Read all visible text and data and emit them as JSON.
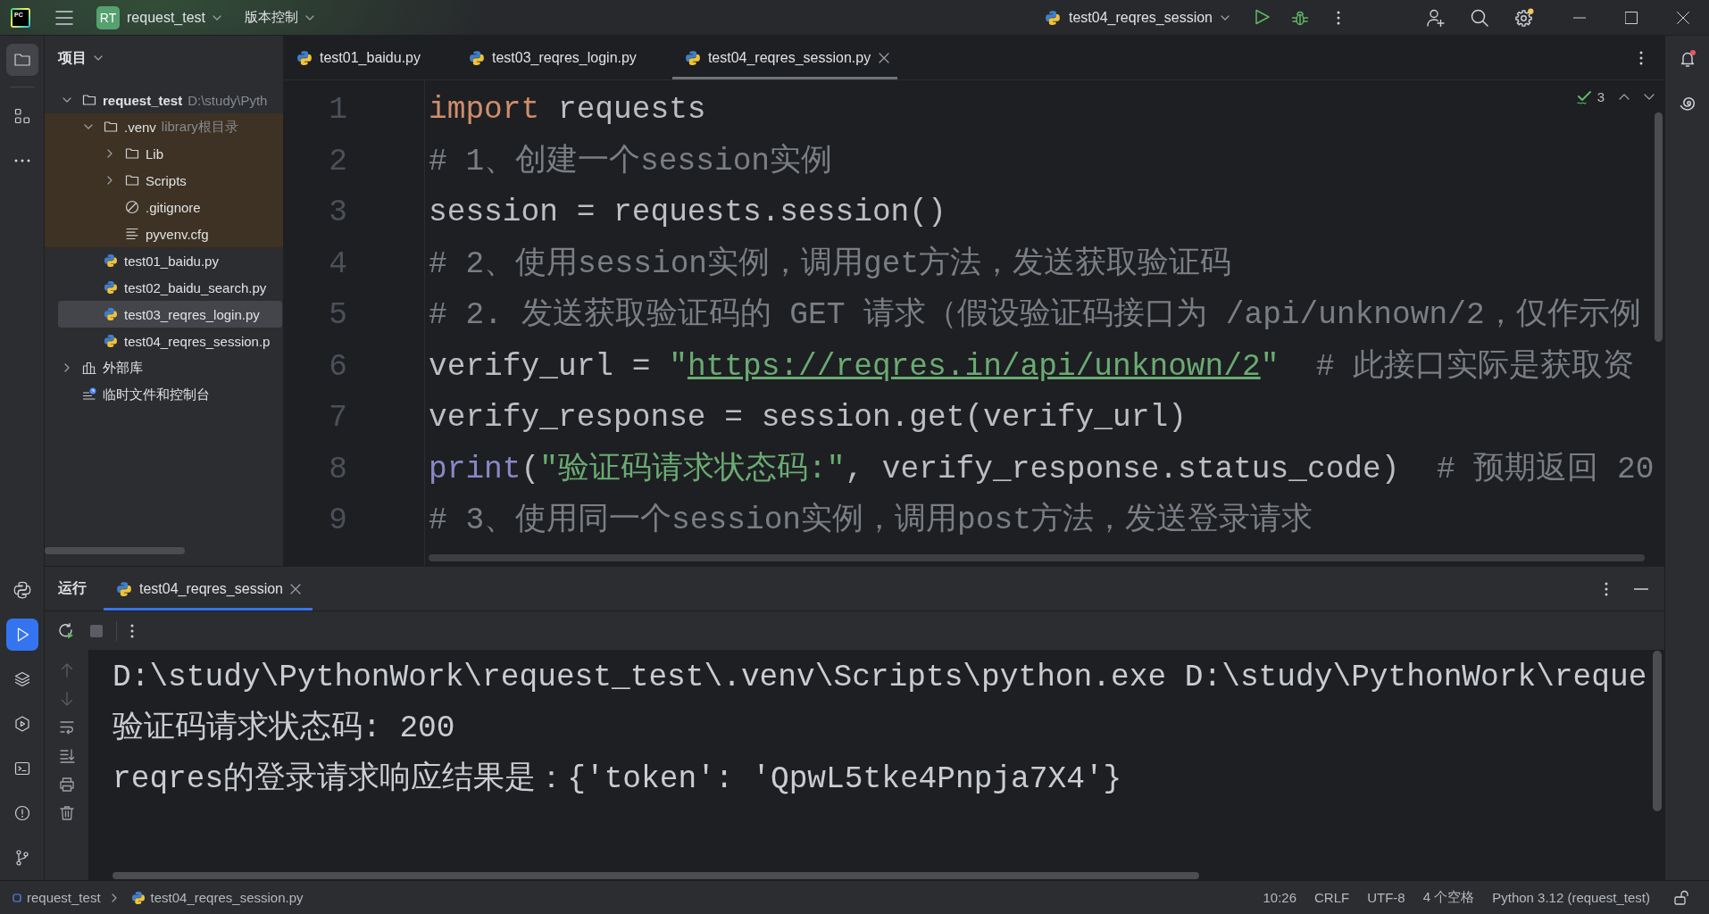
{
  "title_bar": {
    "logo": "PC",
    "project_badge": "RT",
    "project": "request_test",
    "vcs": "版本控制",
    "run_config": "test04_reqres_session",
    "settings_update": true
  },
  "left_toolbar": {
    "top": [
      {
        "kind": "project",
        "selected": true
      },
      {
        "kind": "structure",
        "selected": false
      },
      {
        "kind": "more",
        "selected": false
      }
    ],
    "bottom": [
      {
        "kind": "python_console",
        "selected": false
      },
      {
        "kind": "run",
        "selected": true
      },
      {
        "kind": "layers",
        "selected": false
      },
      {
        "kind": "services",
        "selected": false
      },
      {
        "kind": "terminal",
        "selected": false
      },
      {
        "kind": "problems",
        "selected": false
      },
      {
        "kind": "git",
        "selected": false
      }
    ]
  },
  "project_panel": {
    "title": "项目",
    "tree": [
      {
        "label": "request_test",
        "hint": "D:\\study\\Pyth",
        "kind": "module",
        "expanded": true,
        "selected": false,
        "children": [
          {
            "label": ".venv",
            "hint": "library根目录",
            "kind": "folder",
            "expanded": true,
            "excluded": true,
            "selected": false,
            "children": [
              {
                "label": "Lib",
                "kind": "folder",
                "expanded": false,
                "selected": false
              },
              {
                "label": "Scripts",
                "kind": "folder",
                "expanded": false,
                "selected": false
              },
              {
                "label": ".gitignore",
                "kind": "ignore",
                "selected": false
              },
              {
                "label": "pyvenv.cfg",
                "kind": "config",
                "selected": false
              }
            ]
          },
          {
            "label": "test01_baidu.py",
            "kind": "python",
            "selected": false
          },
          {
            "label": "test02_baidu_search.py",
            "kind": "python",
            "selected": false
          },
          {
            "label": "test03_reqres_login.py",
            "kind": "python",
            "selected": true
          },
          {
            "label": "test04_reqres_session.p",
            "kind": "python",
            "selected": false
          }
        ]
      },
      {
        "label": "外部库",
        "kind": "library",
        "expanded": false,
        "selected": false
      },
      {
        "label": "临时文件和控制台",
        "kind": "scratch",
        "selected": false
      }
    ]
  },
  "editor": {
    "tabs": [
      {
        "label": "test01_baidu.py",
        "selected": false
      },
      {
        "label": "test03_reqres_login.py",
        "selected": false
      },
      {
        "label": "test04_reqres_session.py",
        "selected": true
      }
    ],
    "inspections": "3",
    "lines": [
      {
        "number": "1",
        "tokens": [
          {
            "kind": "keyword",
            "text": "import"
          },
          {
            "kind": "plain",
            "text": " requests"
          }
        ]
      },
      {
        "number": "2",
        "tokens": [
          {
            "kind": "comment",
            "text": "# 1、创建一个session实例"
          }
        ]
      },
      {
        "number": "3",
        "tokens": [
          {
            "kind": "plain",
            "text": "session = requests.session()"
          }
        ]
      },
      {
        "number": "4",
        "tokens": [
          {
            "kind": "comment",
            "text": "# 2、使用session实例，调用get方法，发送获取验证码"
          }
        ]
      },
      {
        "number": "5",
        "tokens": [
          {
            "kind": "comment",
            "text": "# 2. 发送获取验证码的 GET 请求（假设验证码接口为 /api/unknown/2，仅作示例"
          }
        ]
      },
      {
        "number": "6",
        "tokens": [
          {
            "kind": "plain",
            "text": "verify_url = "
          },
          {
            "kind": "string",
            "text": "\""
          },
          {
            "kind": "link",
            "text": "https://reqres.in/api/unknown/2"
          },
          {
            "kind": "string",
            "text": "\""
          },
          {
            "kind": "comment",
            "text": "  # 此接口实际是获取资"
          }
        ]
      },
      {
        "number": "7",
        "tokens": [
          {
            "kind": "plain",
            "text": "verify_response = session.get(verify_url)"
          }
        ]
      },
      {
        "number": "8",
        "tokens": [
          {
            "kind": "builtin",
            "text": "print"
          },
          {
            "kind": "plain",
            "text": "("
          },
          {
            "kind": "string",
            "text": "\"验证码请求状态码:\""
          },
          {
            "kind": "plain",
            "text": ", verify_response.status_code)  "
          },
          {
            "kind": "comment",
            "text": "# 预期返回 20"
          }
        ]
      },
      {
        "number": "9",
        "tokens": [
          {
            "kind": "comment",
            "text": "# 3、使用同一个session实例，调用post方法，发送登录请求"
          }
        ]
      }
    ]
  },
  "run_panel": {
    "title": "运行",
    "tabs": [
      {
        "label": "test04_reqres_session",
        "selected": true
      }
    ],
    "toolbar": [
      {
        "kind": "rerun",
        "disabled": false
      },
      {
        "kind": "stop",
        "disabled": true
      }
    ],
    "gutter": [
      {
        "kind": "up",
        "disabled": true
      },
      {
        "kind": "down",
        "disabled": true
      },
      {
        "kind": "wrap",
        "disabled": false
      },
      {
        "kind": "scroll_end",
        "disabled": false
      },
      {
        "kind": "print",
        "disabled": false
      },
      {
        "kind": "clear",
        "disabled": false
      }
    ],
    "output": [
      "D:\\study\\PythonWork\\request_test\\.venv\\Scripts\\python.exe D:\\study\\PythonWork\\reque",
      "验证码请求状态码: 200",
      "reqres的登录请求响应结果是：{'token': 'QpwL5tke4Pnpja7X4'}"
    ]
  },
  "right_toolbar": {
    "notifications_unread": true
  },
  "status_bar": {
    "path": [
      {
        "kind": "module",
        "label": "request_test"
      },
      {
        "kind": "python",
        "label": "test04_reqres_session.py"
      }
    ],
    "caret": "10:26",
    "line_separator": "CRLF",
    "encoding": "UTF-8",
    "indent": "4 个空格",
    "interpreter": "Python 3.12 (request_test)"
  }
}
